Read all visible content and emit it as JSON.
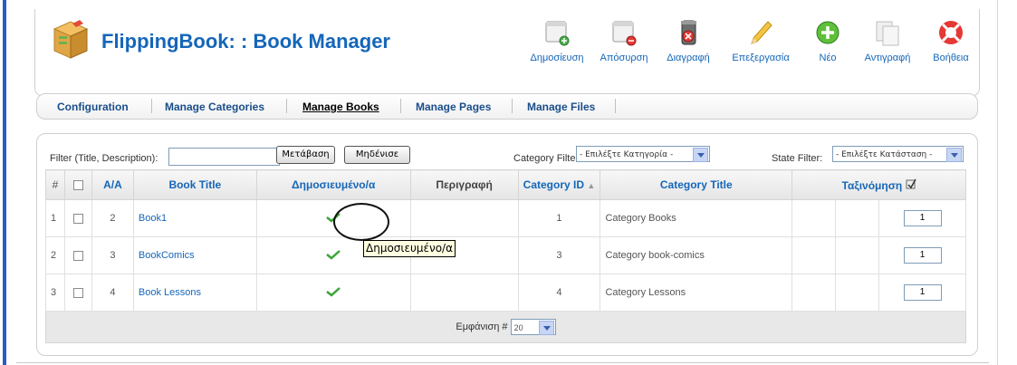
{
  "header": {
    "title": "FlippingBook: : Book Manager",
    "toolbar": [
      {
        "label": "Δημοσίευση",
        "icon": "publish-icon"
      },
      {
        "label": "Απόσυρση",
        "icon": "unpublish-icon"
      },
      {
        "label": "Διαγραφή",
        "icon": "delete-icon"
      },
      {
        "label": "Επεξεργασία",
        "icon": "edit-icon"
      },
      {
        "label": "Νέο",
        "icon": "new-icon"
      },
      {
        "label": "Αντιγραφή",
        "icon": "copy-icon"
      },
      {
        "label": "Βοήθεια",
        "icon": "help-icon"
      }
    ]
  },
  "tabs": [
    {
      "label": "Configuration"
    },
    {
      "label": "Manage Categories"
    },
    {
      "label": "Manage Books",
      "active": true
    },
    {
      "label": "Manage Pages"
    },
    {
      "label": "Manage Files"
    }
  ],
  "filters": {
    "text_label": "Filter (Title, Description):",
    "text_value": "",
    "go_button": "Μετάβαση",
    "reset_button": "Μηδένισε",
    "category_label": "Category Filter:",
    "category_value": "- Επιλέξτε Κατηγορία -",
    "state_label": "State Filter:",
    "state_value": "- Επιλέξτε Κατάσταση -"
  },
  "table": {
    "headers": {
      "num": "#",
      "aa": "A/A",
      "title": "Book Title",
      "published": "Δημοσιευμένο/α",
      "description": "Περιγραφή",
      "category_id": "Category ID",
      "category_title": "Category Title",
      "ordering": "Ταξινόμηση"
    },
    "rows": [
      {
        "num": "1",
        "aa": "2",
        "title": "Book1",
        "description": "",
        "category_id": "1",
        "category_title": "Category Books",
        "order": "1"
      },
      {
        "num": "2",
        "aa": "3",
        "title": "BookComics",
        "description": "",
        "category_id": "3",
        "category_title": "Category book-comics",
        "order": "1"
      },
      {
        "num": "3",
        "aa": "4",
        "title": "Book Lessons",
        "description": "",
        "category_id": "4",
        "category_title": "Category Lessons",
        "order": "1"
      }
    ],
    "footer_label": "Εμφάνιση #",
    "footer_value": "20"
  },
  "tooltip": "Δημοσιευμένο/α",
  "colors": {
    "accent": "#1566b8",
    "check": "#3aa535",
    "side_bar": "#2d59c8"
  }
}
